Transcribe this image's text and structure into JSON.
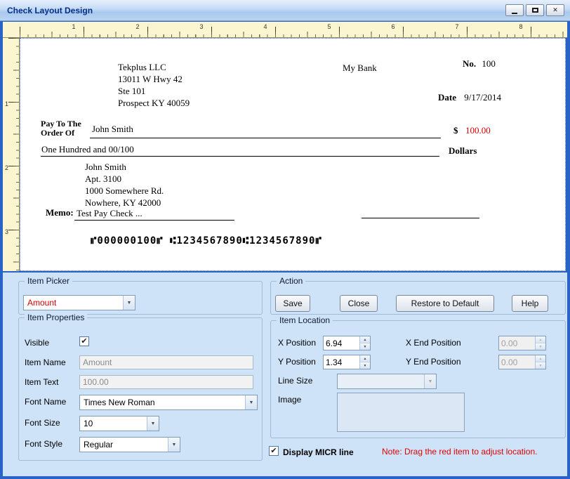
{
  "window": {
    "title": "Check Layout Design"
  },
  "icons": {
    "close": "✕",
    "dropdown": "▼",
    "spin_up": "▲",
    "spin_down": "▼",
    "check": "✔"
  },
  "colors": {
    "amount_red": "#d40000",
    "note_red": "#e00000",
    "panel_blue": "#cfe3f8",
    "ruler_cream": "#fcf6d0"
  },
  "rulers": {
    "horizontal": [
      "1",
      "2",
      "3",
      "4",
      "5",
      "6",
      "7",
      "8"
    ],
    "vertical": [
      "1",
      "2",
      "3"
    ]
  },
  "check": {
    "company_lines": [
      "Tekplus LLC",
      "13011 W Hwy 42",
      "Ste 101",
      "Prospect KY 40059"
    ],
    "bank_name": "My Bank",
    "number_label": "No.",
    "number_value": "100",
    "date_label": "Date",
    "date_value": "9/17/2014",
    "payto_line1": "Pay To The",
    "payto_line2": "Order Of",
    "payee_name": "John Smith",
    "currency_symbol": "$",
    "amount_numeric": "100.00",
    "amount_words": "One Hundred and 00/100",
    "dollars_label": "Dollars",
    "payee_address_lines": [
      "John Smith",
      "Apt. 3100",
      "1000 Somewhere Rd.",
      "Nowhere, KY 42000"
    ],
    "memo_label": "Memo:",
    "memo_text": "Test Pay Check ...",
    "micr_line": "⑈000000100⑈ ⑆1234567890⑆1234567890⑈"
  },
  "item_picker": {
    "group_label": "Item Picker",
    "selected": "Amount"
  },
  "action": {
    "group_label": "Action",
    "save": "Save",
    "close": "Close",
    "restore": "Restore to Default",
    "help": "Help"
  },
  "item_properties": {
    "group_label": "Item Properties",
    "visible_label": "Visible",
    "visible_checked": true,
    "item_name_label": "Item Name",
    "item_name_value": "Amount",
    "item_text_label": "Item Text",
    "item_text_value": "100.00",
    "font_name_label": "Font Name",
    "font_name_value": "Times New Roman",
    "font_size_label": "Font Size",
    "font_size_value": "10",
    "font_style_label": "Font Style",
    "font_style_value": "Regular"
  },
  "item_location": {
    "group_label": "Item Location",
    "x_position_label": "X Position",
    "x_position_value": "6.94",
    "x_end_label": "X End Position",
    "x_end_value": "0.00",
    "y_position_label": "Y Position",
    "y_position_value": "1.34",
    "y_end_label": "Y End Position",
    "y_end_value": "0.00",
    "line_size_label": "Line Size",
    "line_size_value": "",
    "image_label": "Image"
  },
  "footer": {
    "micr_checkbox_label": "Display MICR line",
    "micr_checked": true,
    "note": "Note:  Drag the red item to adjust location."
  }
}
